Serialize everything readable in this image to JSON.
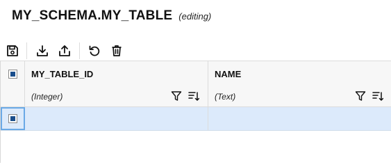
{
  "header": {
    "title": "MY_SCHEMA.MY_TABLE",
    "status": "(editing)"
  },
  "toolbar": {
    "buttons": [
      {
        "name": "save",
        "icon": "save-icon"
      },
      {
        "name": "import",
        "icon": "download-icon"
      },
      {
        "name": "export",
        "icon": "upload-icon"
      },
      {
        "name": "revert",
        "icon": "undo-icon"
      },
      {
        "name": "delete",
        "icon": "trash-icon"
      }
    ]
  },
  "grid": {
    "columns": [
      {
        "name": "MY_TABLE_ID",
        "type": "(Integer)"
      },
      {
        "name": "NAME",
        "type": "(Text)"
      }
    ],
    "rows": [
      {
        "selected": true,
        "values": [
          "",
          ""
        ]
      }
    ]
  },
  "colors": {
    "accent": "#1a4e8c",
    "selected_row": "#dceafb",
    "header_bg": "#f7f7f7"
  }
}
